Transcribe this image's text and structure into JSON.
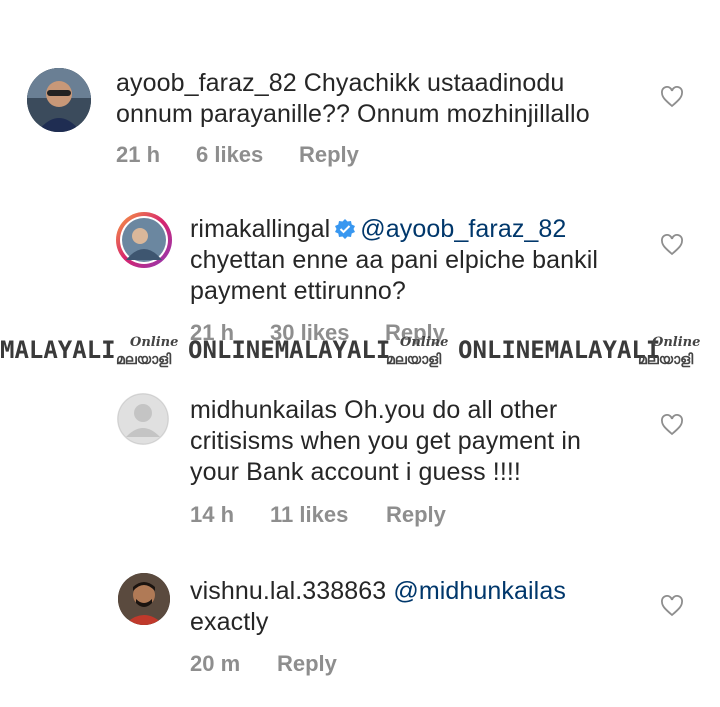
{
  "comments": [
    {
      "username": "ayoob_faraz_82",
      "text_line1": "Chyachikk ustaadinodu",
      "text_line2": "onnum parayanille?? Onnum mozhinjillallo",
      "time": "21 h",
      "likes": "6 likes",
      "reply": "Reply"
    },
    {
      "username": "rimakallingal",
      "mention": "@ayoob_faraz_82",
      "text_line1": "chyettan enne aa pani elpiche bankil",
      "text_line2": "payment ettirunno?",
      "time": "21 h",
      "likes": "30 likes",
      "reply": "Reply"
    },
    {
      "username": "midhunkailas",
      "text_line1": "Oh.you do all other",
      "text_line2": "critisisms when you get payment in",
      "text_line3": "your Bank account i guess !!!!",
      "time": "14 h",
      "likes": "11 likes",
      "reply": "Reply"
    },
    {
      "username": "vishnu.lal.338863",
      "mention": "@midhunkailas",
      "text_line1": "exactly",
      "time": "20 m",
      "reply": "Reply"
    }
  ],
  "watermark": {
    "text1": "MALAYALI",
    "text2": "ONLINEMALAYALI",
    "text3": "ONLINEMALAYALI",
    "logo_top": "Online",
    "logo_bottom": "മലയാളി"
  },
  "colors": {
    "text": "#262626",
    "meta": "#8e8e8e",
    "mention": "#00376b",
    "verified": "#3897f0"
  }
}
